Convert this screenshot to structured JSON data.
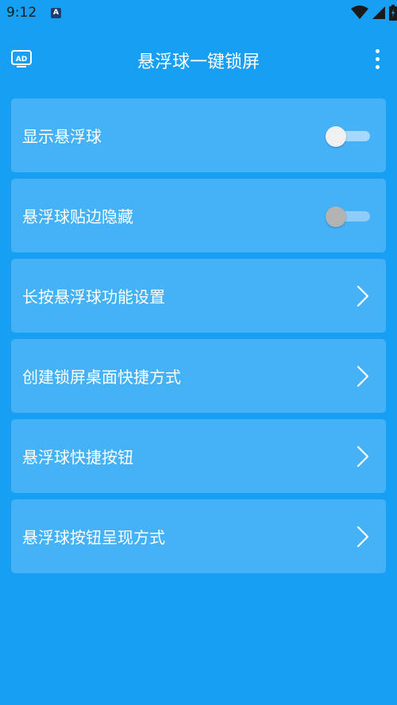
{
  "status_bar": {
    "time": "9:12",
    "notification_icon_text": "A",
    "icons": [
      "wifi-icon",
      "signal-icon",
      "battery-icon"
    ]
  },
  "app_bar": {
    "title": "悬浮球一键锁屏",
    "left_icon": "ad-monitor-icon",
    "left_icon_text": "AD",
    "right_icon": "more-vert-icon"
  },
  "settings": [
    {
      "label": "显示悬浮球",
      "control": "switch",
      "checked": false
    },
    {
      "label": "悬浮球贴边隐藏",
      "control": "switch",
      "checked": false,
      "disabled": true
    },
    {
      "label": "长按悬浮球功能设置",
      "control": "chevron"
    },
    {
      "label": "创建锁屏桌面快捷方式",
      "control": "chevron"
    },
    {
      "label": "悬浮球快捷按钮",
      "control": "chevron"
    },
    {
      "label": "悬浮球按钮呈现方式",
      "control": "chevron"
    }
  ],
  "colors": {
    "background": "#17a0f3",
    "card": "#45b2f7",
    "text": "#ffffff"
  }
}
